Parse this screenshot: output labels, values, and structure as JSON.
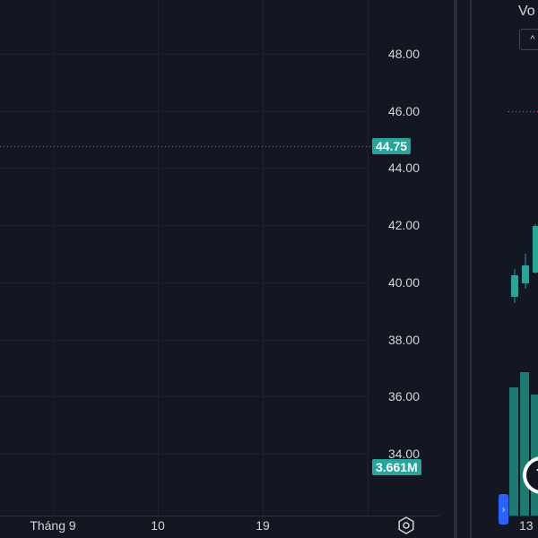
{
  "left_chart": {
    "price_axis": [
      "48.00",
      "46.00",
      "44.00",
      "42.00",
      "40.00",
      "38.00",
      "36.00",
      "34.00"
    ],
    "last_price": "44.75",
    "volume_value": "3.661M",
    "time_axis": [
      "Tháng 9",
      "10",
      "19"
    ],
    "settings_icon": "gear-icon",
    "last_price_color": "#26a69a"
  },
  "right_chart": {
    "title_partial": "Vo",
    "collapse_icon": "chevron-up-icon",
    "time_label": "13",
    "scroll_icon": "chevron-right-icon",
    "logo_text": "T"
  },
  "colors": {
    "background": "#131722",
    "grid": "#1e222d",
    "up": "#26a69a",
    "down": "#ef5350",
    "accent_blue": "#2962ff"
  }
}
